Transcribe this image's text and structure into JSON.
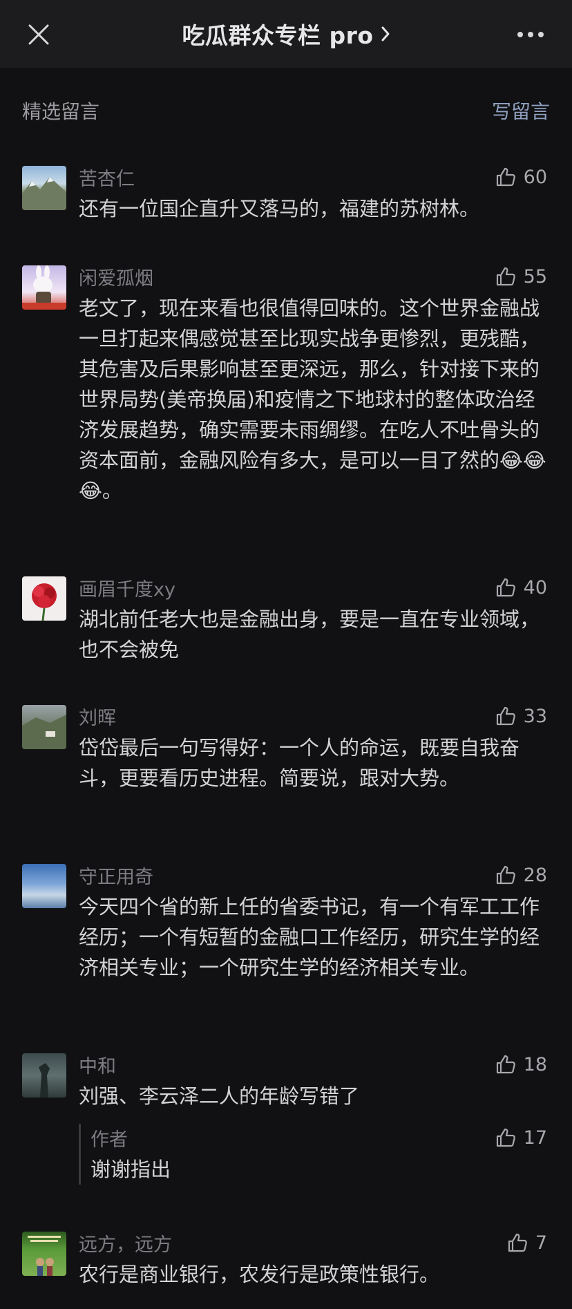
{
  "header": {
    "title": "吃瓜群众专栏 pro",
    "close_icon": "close-icon",
    "more_icon": "more-icon",
    "chevron_icon": "chevron-right-icon"
  },
  "section": {
    "title": "精选留言",
    "write_label": "写留言"
  },
  "comments": [
    {
      "nickname": "苦杏仁",
      "likes": "60",
      "text": "还有一位国企直升又落马的，福建的苏树林。"
    },
    {
      "nickname": "闲爱孤烟",
      "likes": "55",
      "text": "老文了，现在来看也很值得回味的。这个世界金融战一旦打起来偶感觉甚至比现实战争更惨烈，更残酷，其危害及后果影响甚至更深远，那么，针对接下来的世界局势(美帝换届)和疫情之下地球村的整体政治经济发展趋势，确实需要未雨绸缪。在吃人不吐骨头的资本面前，金融风险有多大，是可以一目了然的😂😂😂。"
    },
    {
      "nickname": "画眉千度xy",
      "likes": "40",
      "text": "湖北前任老大也是金融出身，要是一直在专业领域，也不会被免"
    },
    {
      "nickname": "刘晖",
      "likes": "33",
      "text": "岱岱最后一句写得好：一个人的命运，既要自我奋斗，更要看历史进程。简要说，跟对大势。"
    },
    {
      "nickname": "守正用奇",
      "likes": "28",
      "text": "今天四个省的新上任的省委书记，有一个有军工工作经历；一个有短暂的金融口工作经历，研究生学的经济相关专业；一个研究生学的经济相关专业。"
    },
    {
      "nickname": "中和",
      "likes": "18",
      "text": "刘强、李云泽二人的年龄写错了",
      "reply": {
        "nickname": "作者",
        "likes": "17",
        "text": "谢谢指出"
      }
    },
    {
      "nickname": "远方，远方",
      "likes": "7",
      "text": "农行是商业银行，农发行是政策性银行。"
    }
  ],
  "colors": {
    "background": "#111113",
    "header_bg": "#1c1c1e",
    "link": "#8fa0bf",
    "nickname": "#7c7c82",
    "content": "#d3d3d6"
  }
}
